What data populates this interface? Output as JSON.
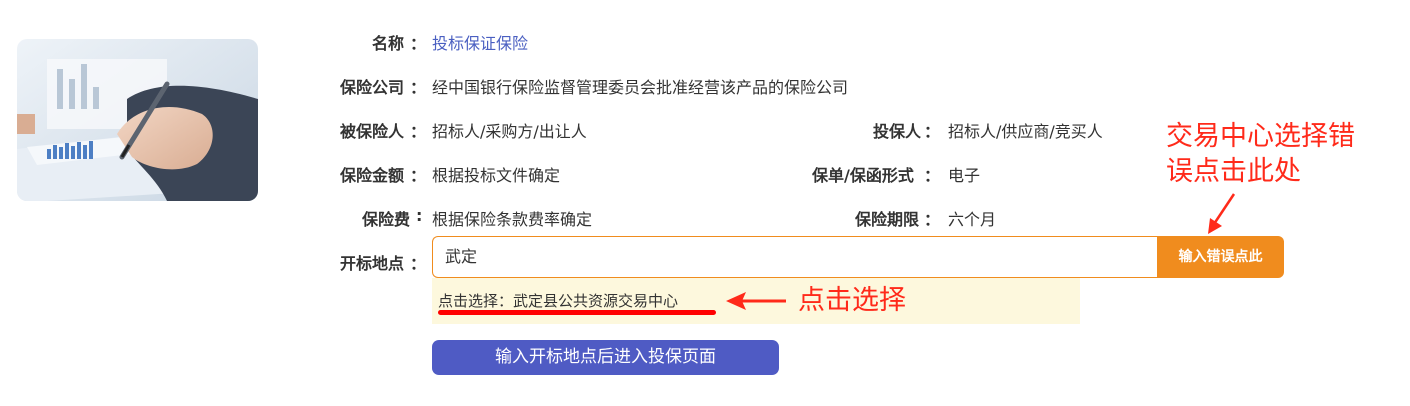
{
  "colors": {
    "accent_orange": "#f08c1e",
    "primary_blue": "#4f5bc4",
    "link_blue": "#4a5fc1",
    "annotation_red": "#ff2a1a",
    "suggestion_bg": "#fdf8dd"
  },
  "fields": {
    "name": {
      "label": "名称",
      "value": "投标保证保险"
    },
    "insurer": {
      "label": "保险公司",
      "value": "经中国银行保险监督管理委员会批准经营该产品的保险公司"
    },
    "insured": {
      "label": "被保险人",
      "value": "招标人/采购方/出让人"
    },
    "policyholder": {
      "label": "投保人",
      "value": "招标人/供应商/竞买人"
    },
    "amount": {
      "label": "保险金额",
      "value": "根据投标文件确定"
    },
    "form": {
      "label": "保单/保函形式",
      "value": "电子"
    },
    "premium": {
      "label": "保险费",
      "value": "根据保险条款费率确定"
    },
    "period": {
      "label": "保险期限",
      "value": "六个月"
    },
    "location": {
      "label": "开标地点",
      "value": "武定"
    }
  },
  "colon": "：",
  "buttons": {
    "error": "输入错误点此",
    "enter": "输入开标地点后进入投保页面"
  },
  "suggestion": {
    "prefix": "点击选择：",
    "value": "武定县公共资源交易中心"
  },
  "annotations": {
    "error_line1": "交易中心选择错",
    "error_line2": "误点击此处",
    "select": "点击选择"
  },
  "icons": [
    "contract-signing-image",
    "arrow-left-icon",
    "arrow-down-icon"
  ]
}
